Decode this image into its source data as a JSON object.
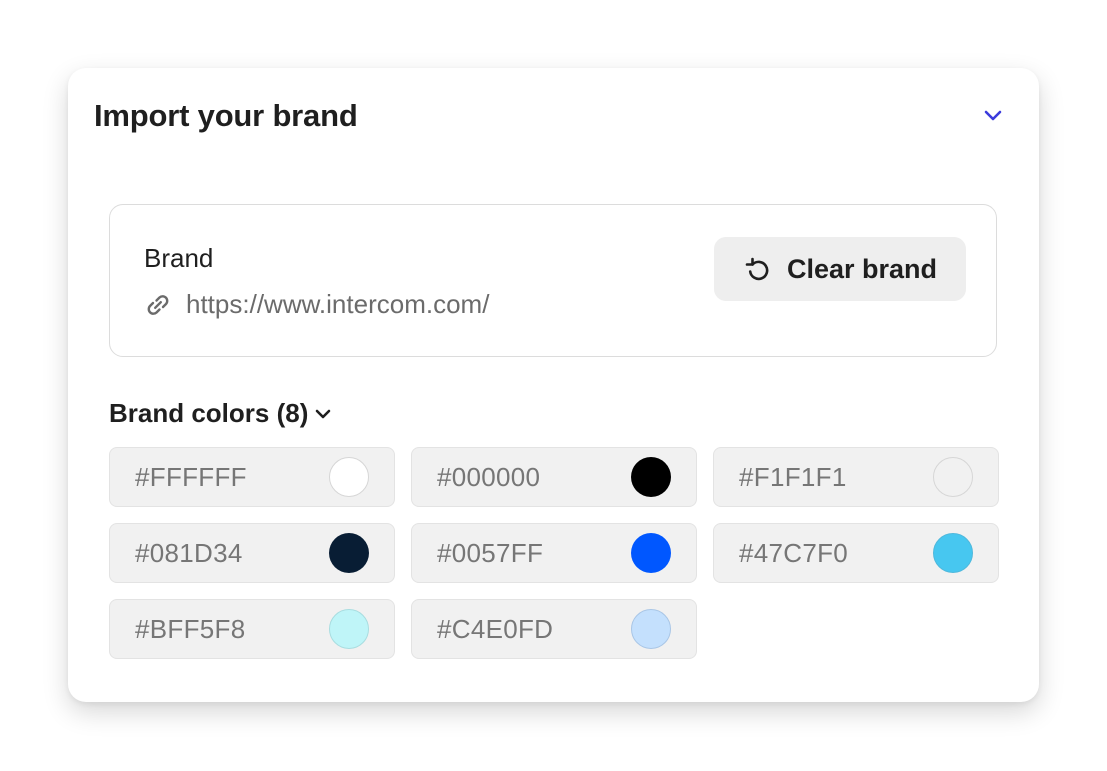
{
  "panel": {
    "title": "Import your brand",
    "toggle_icon": "chevron-down-icon",
    "accent_color": "#3b3bdc"
  },
  "brand": {
    "label": "Brand",
    "url": "https://www.intercom.com/",
    "url_icon": "link-icon",
    "clear_button": {
      "label": "Clear brand",
      "icon": "reset-icon"
    }
  },
  "brand_colors": {
    "title": "Brand colors (8)",
    "toggle_icon": "chevron-down-icon",
    "swatches": [
      {
        "hex": "#FFFFFF",
        "color": "#FFFFFF"
      },
      {
        "hex": "#000000",
        "color": "#000000"
      },
      {
        "hex": "#F1F1F1",
        "color": "#F1F1F1"
      },
      {
        "hex": "#081D34",
        "color": "#081D34"
      },
      {
        "hex": "#0057FF",
        "color": "#0057FF"
      },
      {
        "hex": "#47C7F0",
        "color": "#47C7F0"
      },
      {
        "hex": "#BFF5F8",
        "color": "#BFF5F8"
      },
      {
        "hex": "#C4E0FD",
        "color": "#C4E0FD"
      }
    ]
  }
}
